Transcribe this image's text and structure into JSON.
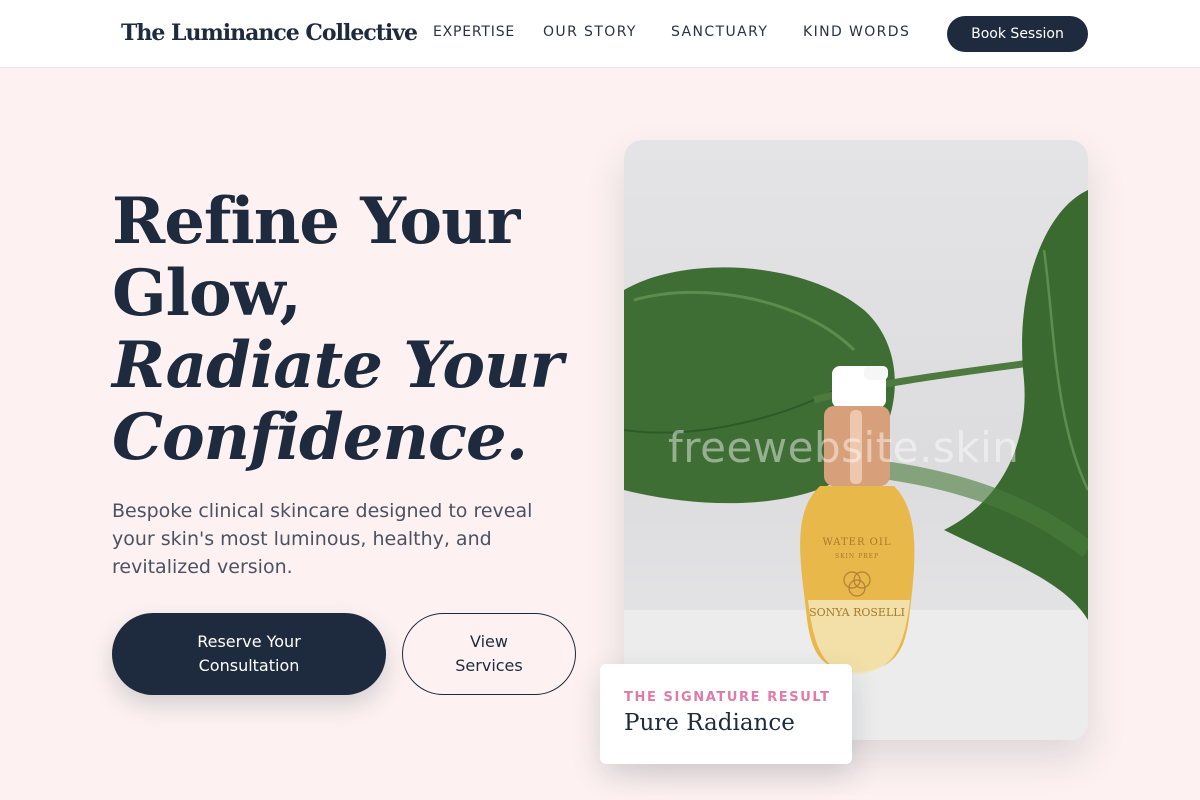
{
  "header": {
    "brand": "The Luminance Collective",
    "nav": [
      "EXPERTISE",
      "OUR STORY",
      "SANCTUARY",
      "KIND WORDS"
    ],
    "cta_label": "Book Session"
  },
  "hero": {
    "title_line1": "Refine Your",
    "title_line2": "Glow,",
    "title_line3": "Radiate Your",
    "title_line4": "Confidence.",
    "subtitle": "Bespoke clinical skincare designed to reveal your skin's most luminous, healthy, and revitalized version.",
    "primary_cta": "Reserve Your Consultation",
    "secondary_cta": "View Services"
  },
  "product_image": {
    "watermark": "freewebsite.skin",
    "bottle_label_top": "WATER OIL",
    "bottle_label_sub": "SKIN PREP",
    "bottle_brand": "SONYA ROSELLI"
  },
  "result_card": {
    "eyebrow": "THE SIGNATURE RESULT",
    "title": "Pure Radiance"
  },
  "colors": {
    "navy": "#1e2a3d",
    "blush_background": "#fdf2f1",
    "pink_accent": "#e07aa8",
    "gold": "#e8b84a"
  }
}
